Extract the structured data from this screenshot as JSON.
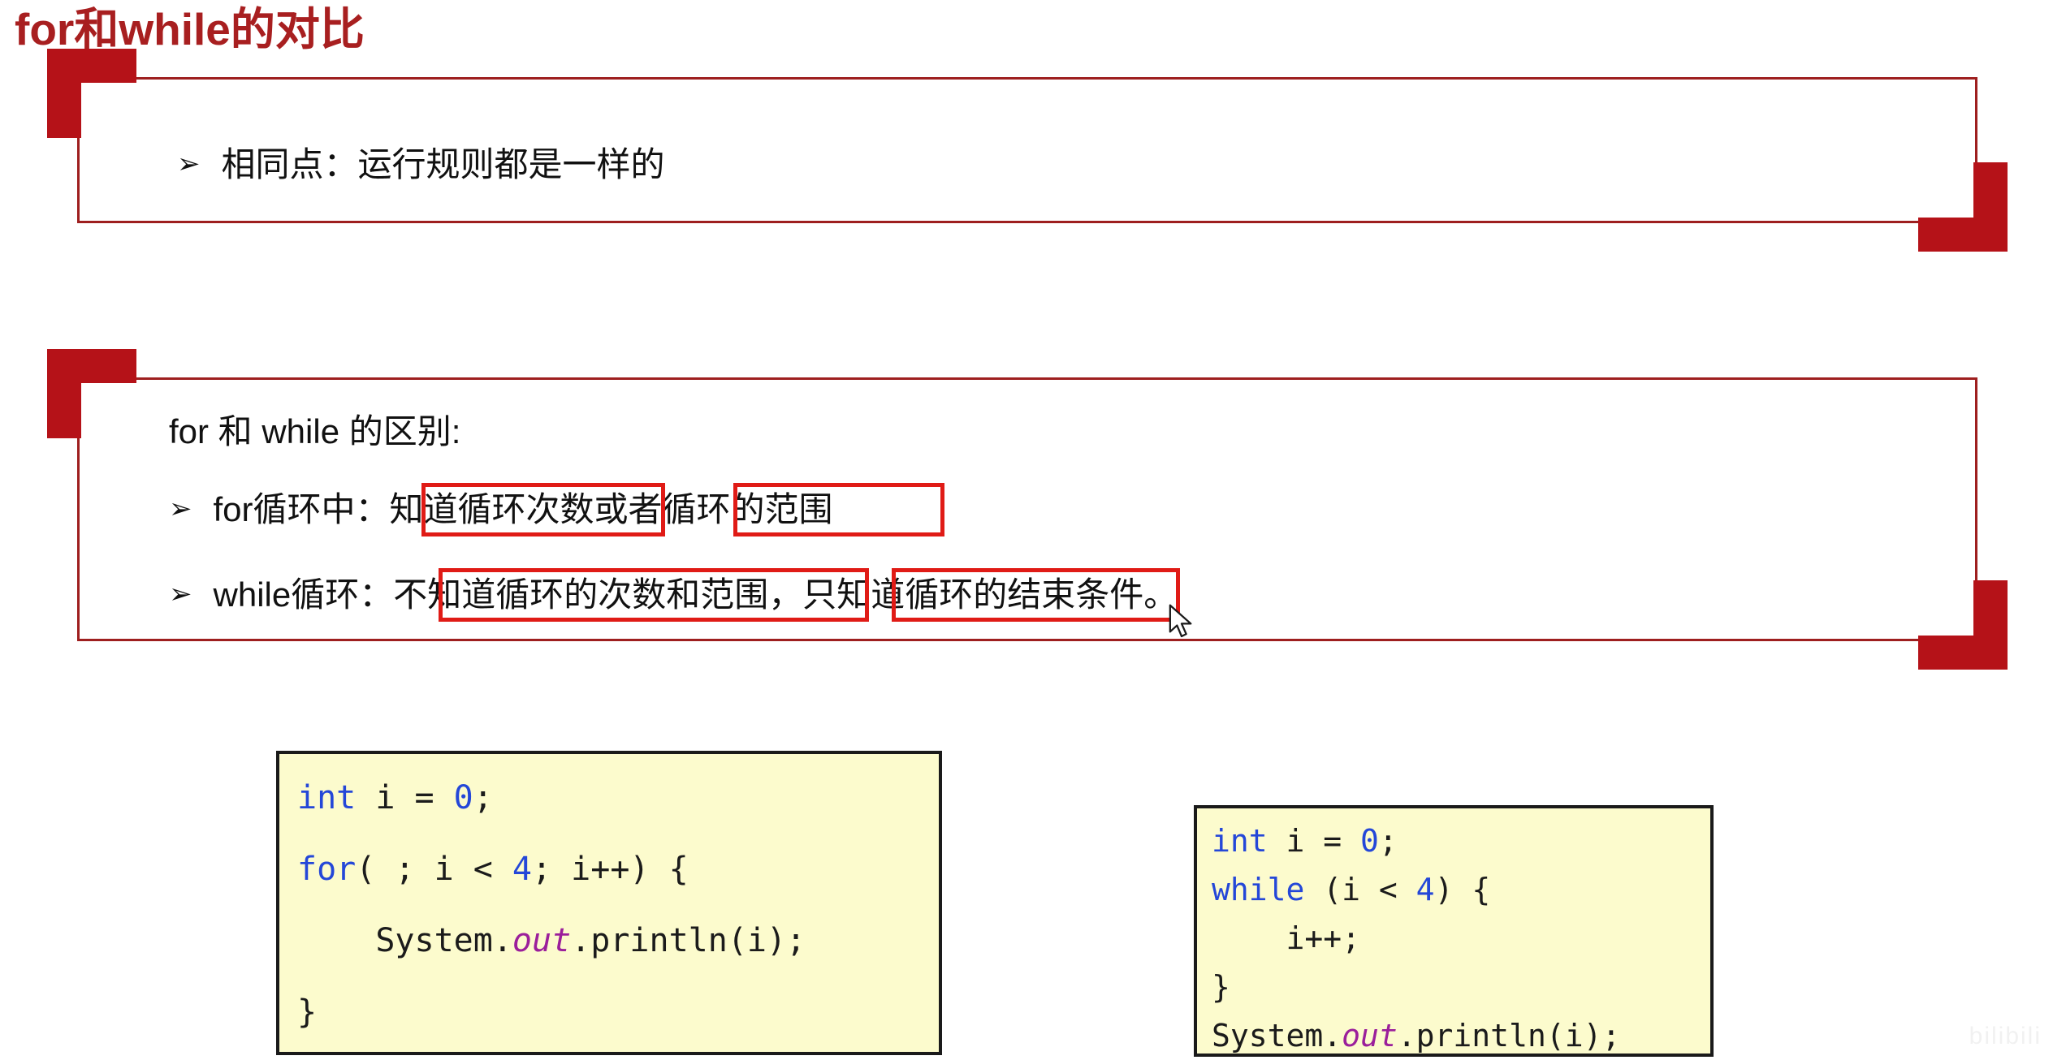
{
  "slide": {
    "title": "for和while的对比",
    "title_color": "#a81f20"
  },
  "panel_one": {
    "bullet_glyph": "➢",
    "bullet_text": "相同点：运行规则都是一样的"
  },
  "panel_two": {
    "heading": "for 和 while 的区别:",
    "bullets": [
      {
        "glyph": "➢",
        "prefix": "for循环中：",
        "highlight_one": "知道循环次数",
        "middle": "或者",
        "highlight_two": "循环的范围",
        "suffix": ""
      },
      {
        "glyph": "➢",
        "prefix": "while循环：",
        "highlight_one": "不知道循环的次数和范围",
        "middle": "，",
        "highlight_two": "只知道循环的结",
        "suffix": "束条件。"
      }
    ],
    "highlight_color": "#e01b16"
  },
  "code_left": {
    "lines": [
      [
        {
          "t": "int",
          "c": "kw"
        },
        {
          "t": " i = ",
          "c": ""
        },
        {
          "t": "0",
          "c": "num"
        },
        {
          "t": ";",
          "c": ""
        }
      ],
      [
        {
          "t": "for",
          "c": "kw"
        },
        {
          "t": "( ; i < ",
          "c": ""
        },
        {
          "t": "4",
          "c": "num"
        },
        {
          "t": "; i++) {",
          "c": ""
        }
      ],
      [
        {
          "t": "    System.",
          "c": ""
        },
        {
          "t": "out",
          "c": "fld"
        },
        {
          "t": ".println(i);",
          "c": ""
        }
      ],
      [
        {
          "t": "}",
          "c": ""
        }
      ]
    ]
  },
  "code_right": {
    "lines": [
      [
        {
          "t": "int",
          "c": "kw"
        },
        {
          "t": " i = ",
          "c": ""
        },
        {
          "t": "0",
          "c": "num"
        },
        {
          "t": ";",
          "c": ""
        }
      ],
      [
        {
          "t": "while",
          "c": "kw"
        },
        {
          "t": " (i < ",
          "c": ""
        },
        {
          "t": "4",
          "c": "num"
        },
        {
          "t": ") {",
          "c": ""
        }
      ],
      [
        {
          "t": "    i++;",
          "c": ""
        }
      ],
      [
        {
          "t": "}",
          "c": ""
        }
      ],
      [
        {
          "t": "System.",
          "c": ""
        },
        {
          "t": "out",
          "c": "fld"
        },
        {
          "t": ".println(i);",
          "c": ""
        }
      ]
    ]
  },
  "watermark": {
    "text": "bilibili"
  }
}
